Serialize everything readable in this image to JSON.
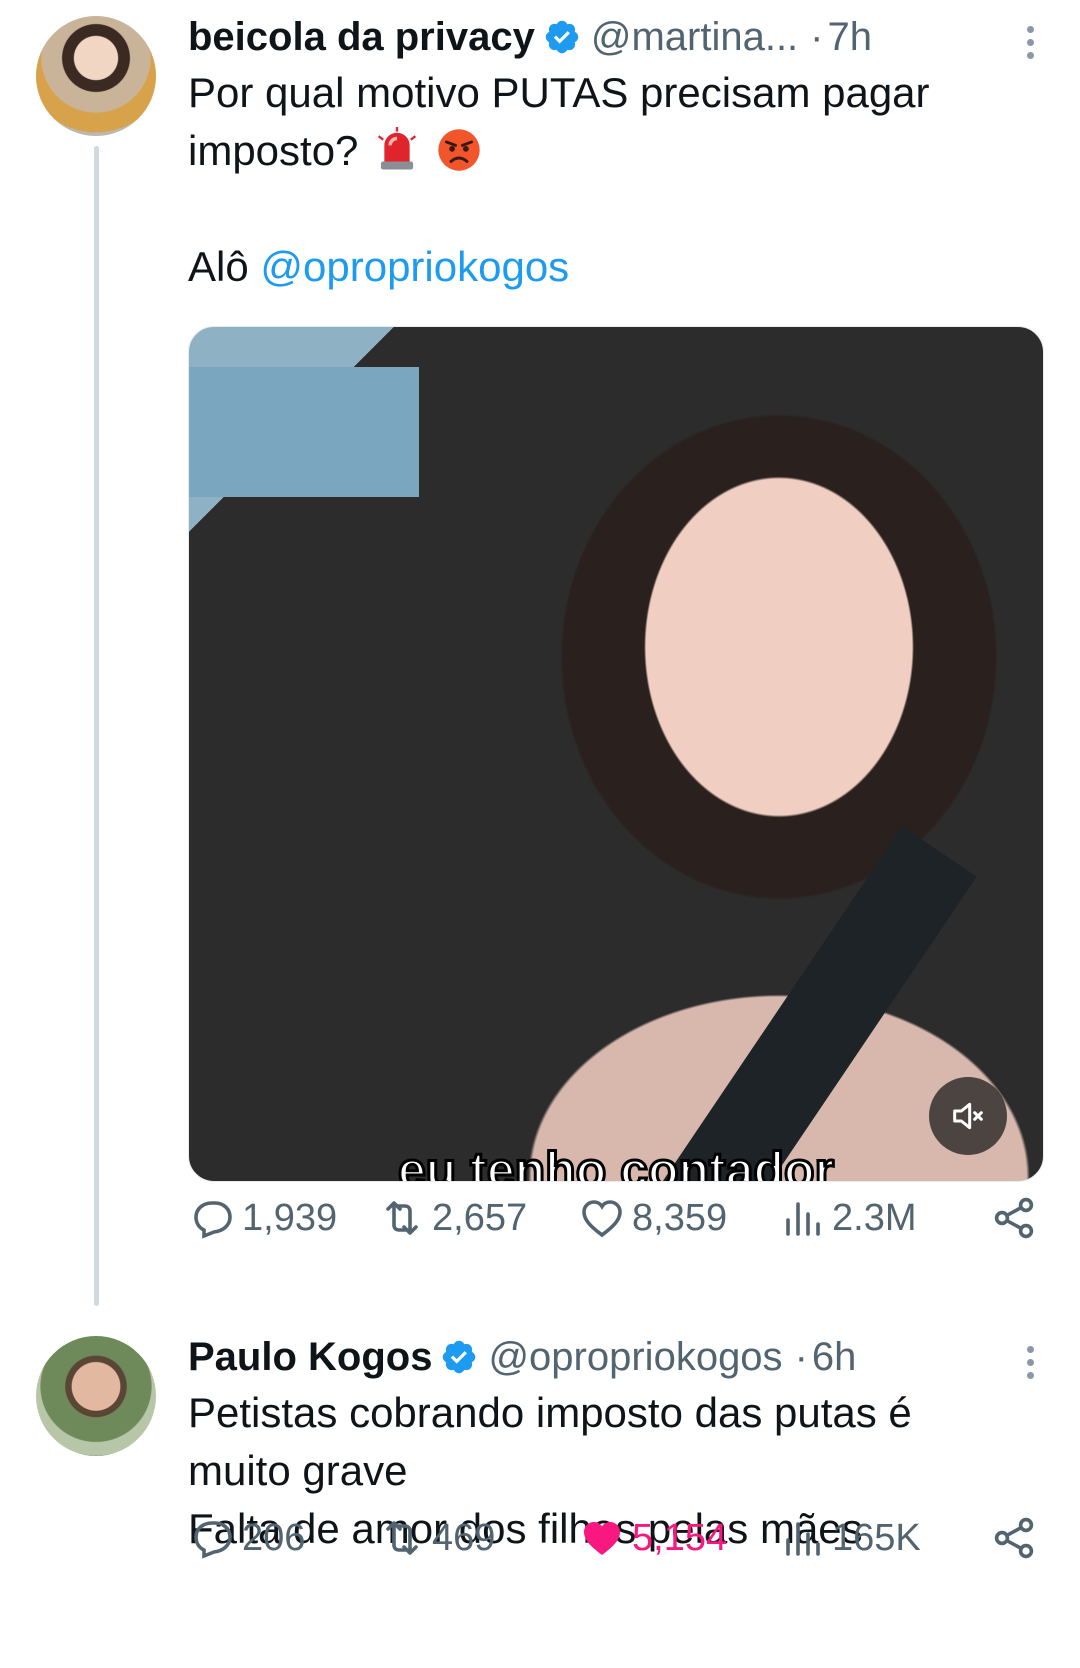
{
  "colors": {
    "accent": "#1d9bf0",
    "like": "#f91880",
    "muted": "#536471",
    "text": "#0f1419"
  },
  "tweets": [
    {
      "name": "beicola da privacy",
      "handle": "@martina...",
      "time": "7h",
      "text_line1": "Por qual motivo PUTAS precisam pagar",
      "text_line2": "imposto?",
      "emojis": [
        "police-light-emoji",
        "angry-face-emoji"
      ],
      "text_prefix": "Alô",
      "mention": "@opropriokogos",
      "video_caption": "eu tenho contador",
      "video_muted": true,
      "replies": "1,939",
      "retweets": "2,657",
      "likes": "8,359",
      "views": "2.3M",
      "liked": false
    },
    {
      "name": "Paulo Kogos",
      "handle": "@opropriokogos",
      "time": "6h",
      "text_line1": "Petistas cobrando imposto das putas é",
      "text_line2": "muito grave",
      "text_line3": "Falta de amor dos filhos pelas mães",
      "replies": "206",
      "retweets": "469",
      "likes": "5,154",
      "views": "165K",
      "liked": true
    }
  ]
}
